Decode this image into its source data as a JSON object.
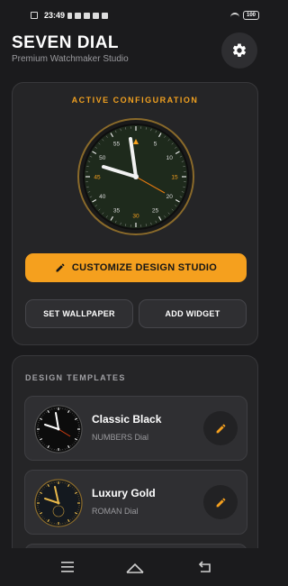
{
  "status_bar": {
    "time": "23:49",
    "battery": "100"
  },
  "header": {
    "title": "SEVEN DIAL",
    "subtitle": "Premium Watchmaker Studio",
    "settings_icon": "gear-icon"
  },
  "active_config": {
    "label": "ACTIVE CONFIGURATION",
    "dial_numbers": [
      "5",
      "10",
      "15",
      "20",
      "25",
      "30",
      "35",
      "40",
      "45",
      "50",
      "55"
    ],
    "customize_label": "CUSTOMIZE DESIGN STUDIO",
    "set_wallpaper_label": "SET WALLPAPER",
    "add_widget_label": "ADD WIDGET"
  },
  "templates": {
    "heading": "DESIGN TEMPLATES",
    "items": [
      {
        "name": "Classic Black",
        "type": "NUMBERS Dial"
      },
      {
        "name": "Luxury Gold",
        "type": "ROMAN Dial"
      }
    ]
  },
  "colors": {
    "accent": "#f5a01e",
    "background": "#1b1b1d",
    "card": "#252527"
  }
}
